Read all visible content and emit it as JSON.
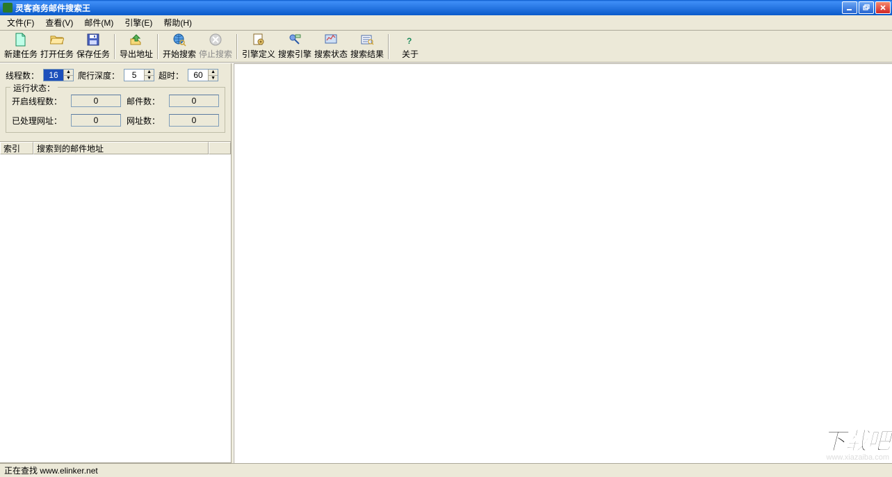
{
  "title": "灵客商务邮件搜索王",
  "menu": {
    "file": "文件(F)",
    "view": "查看(V)",
    "mail": "邮件(M)",
    "engine": "引擎(E)",
    "help": "帮助(H)"
  },
  "toolbar": {
    "new_task": "新建任务",
    "open_task": "打开任务",
    "save_task": "保存任务",
    "export_addr": "导出地址",
    "start_search": "开始搜索",
    "stop_search": "停止搜索",
    "engine_def": "引擎定义",
    "search_engine": "搜索引擎",
    "search_status": "搜索状态",
    "search_result": "搜索结果",
    "about": "关于"
  },
  "params": {
    "threads_label": "线程数：",
    "threads_value": "16",
    "depth_label": "爬行深度：",
    "depth_value": "5",
    "timeout_label": "超时：",
    "timeout_value": "60"
  },
  "status_group": {
    "legend": "运行状态：",
    "open_threads_label": "开启线程数：",
    "open_threads_value": "0",
    "mail_count_label": "邮件数：",
    "mail_count_value": "0",
    "processed_url_label": "已处理网址：",
    "processed_url_value": "0",
    "url_count_label": "网址数：",
    "url_count_value": "0"
  },
  "listview": {
    "col_index": "索引",
    "col_addr": "搜索到的邮件地址"
  },
  "statusbar": {
    "text": "正在查找 www.elinker.net"
  },
  "watermark": {
    "big": "下载吧",
    "small": "www.xiazaiba.com"
  }
}
